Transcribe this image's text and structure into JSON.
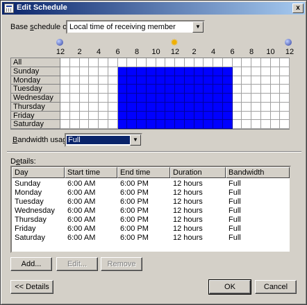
{
  "window": {
    "title": "Edit Schedule",
    "close_glyph": "x"
  },
  "base_schedule": {
    "label_pre": "Base ",
    "label_accel": "s",
    "label_post": "chedule on:",
    "value": "Local time of receiving member"
  },
  "hour_labels": [
    "12",
    "2",
    "4",
    "6",
    "8",
    "10",
    "12",
    "2",
    "4",
    "6",
    "8",
    "10",
    "12"
  ],
  "grid": {
    "rows": [
      "All",
      "Sunday",
      "Monday",
      "Tuesday",
      "Wednesday",
      "Thursday",
      "Friday",
      "Saturday"
    ],
    "active_start_hour": 6,
    "active_end_hour": 18,
    "hours": 24
  },
  "bandwidth": {
    "label_accel": "B",
    "label_post": "andwidth usage:",
    "value": "Full"
  },
  "details": {
    "label_pre": "D",
    "label_accel": "e",
    "label_post": "tails:",
    "columns": [
      "Day",
      "Start time",
      "End time",
      "Duration",
      "Bandwidth"
    ],
    "rows": [
      [
        "Sunday",
        "6:00 AM",
        "6:00 PM",
        "12 hours",
        "Full"
      ],
      [
        "Monday",
        "6:00 AM",
        "6:00 PM",
        "12 hours",
        "Full"
      ],
      [
        "Tuesday",
        "6:00 AM",
        "6:00 PM",
        "12 hours",
        "Full"
      ],
      [
        "Wednesday",
        "6:00 AM",
        "6:00 PM",
        "12 hours",
        "Full"
      ],
      [
        "Thursday",
        "6:00 AM",
        "6:00 PM",
        "12 hours",
        "Full"
      ],
      [
        "Friday",
        "6:00 AM",
        "6:00 PM",
        "12 hours",
        "Full"
      ],
      [
        "Saturday",
        "6:00 AM",
        "6:00 PM",
        "12 hours",
        "Full"
      ]
    ]
  },
  "buttons": {
    "add": "Add...",
    "edit": "Edit...",
    "remove": "Remove",
    "details_toggle": "<< Details",
    "ok": "OK",
    "cancel": "Cancel"
  },
  "colors": {
    "active_cell": "#0000ff",
    "title_bar": "#0a246a"
  }
}
